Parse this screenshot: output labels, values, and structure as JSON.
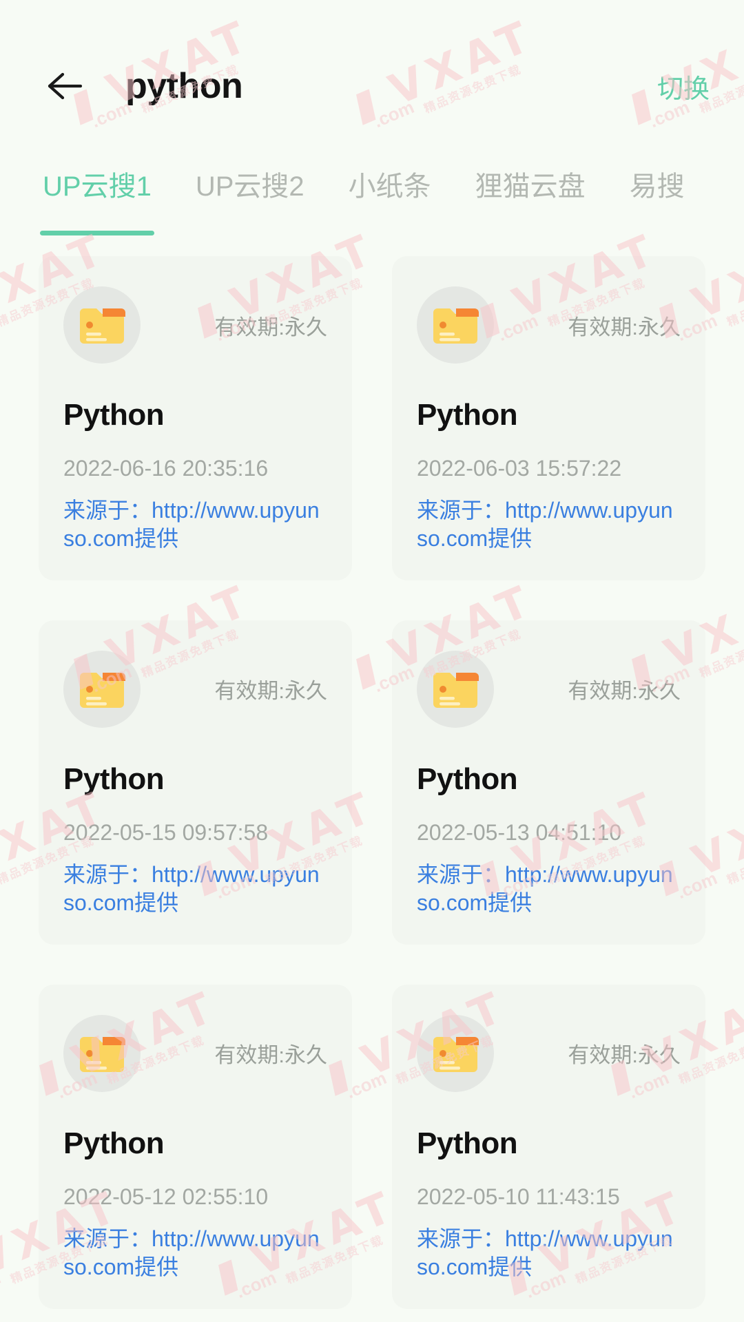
{
  "header": {
    "back_icon": "arrow-left-icon",
    "title": "python",
    "switch_label": "切换"
  },
  "tabs": [
    {
      "label": "UP云搜1",
      "active": true
    },
    {
      "label": "UP云搜2",
      "active": false
    },
    {
      "label": "小纸条",
      "active": false
    },
    {
      "label": "狸猫云盘",
      "active": false
    },
    {
      "label": "易搜",
      "active": false
    }
  ],
  "colors": {
    "accent": "#62cfa9",
    "page_background": "#f7fbf5",
    "card_background": "#f2f6f0",
    "link": "#3a7fe0",
    "muted_text": "#a3a8a3",
    "title_text": "#111111",
    "watermark": "#f9c4c9",
    "folder_body": "#fbd45f",
    "folder_tab": "#f58634"
  },
  "watermark": {
    "slashes": "///",
    "main": "VXAT",
    "dotcom": ".com",
    "sub": "精品资源免费下载"
  },
  "results": [
    {
      "icon": "folder-icon",
      "validity": "有效期:永久",
      "title": "Python",
      "date": "2022-06-16 20:35:16",
      "source": "来源于：http://www.upyunso.com提供"
    },
    {
      "icon": "folder-icon",
      "validity": "有效期:永久",
      "title": "Python",
      "date": "2022-06-03 15:57:22",
      "source": "来源于：http://www.upyunso.com提供"
    },
    {
      "icon": "folder-icon",
      "validity": "有效期:永久",
      "title": "Python",
      "date": "2022-05-15 09:57:58",
      "source": "来源于：http://www.upyunso.com提供"
    },
    {
      "icon": "folder-icon",
      "validity": "有效期:永久",
      "title": "Python",
      "date": "2022-05-13 04:51:10",
      "source": "来源于：http://www.upyunso.com提供"
    },
    {
      "icon": "folder-icon",
      "validity": "有效期:永久",
      "title": "Python",
      "date": "2022-05-12 02:55:10",
      "source": "来源于：http://www.upyunso.com提供"
    },
    {
      "icon": "folder-icon",
      "validity": "有效期:永久",
      "title": "Python",
      "date": "2022-05-10 11:43:15",
      "source": "来源于：http://www.upyunso.com提供"
    }
  ]
}
